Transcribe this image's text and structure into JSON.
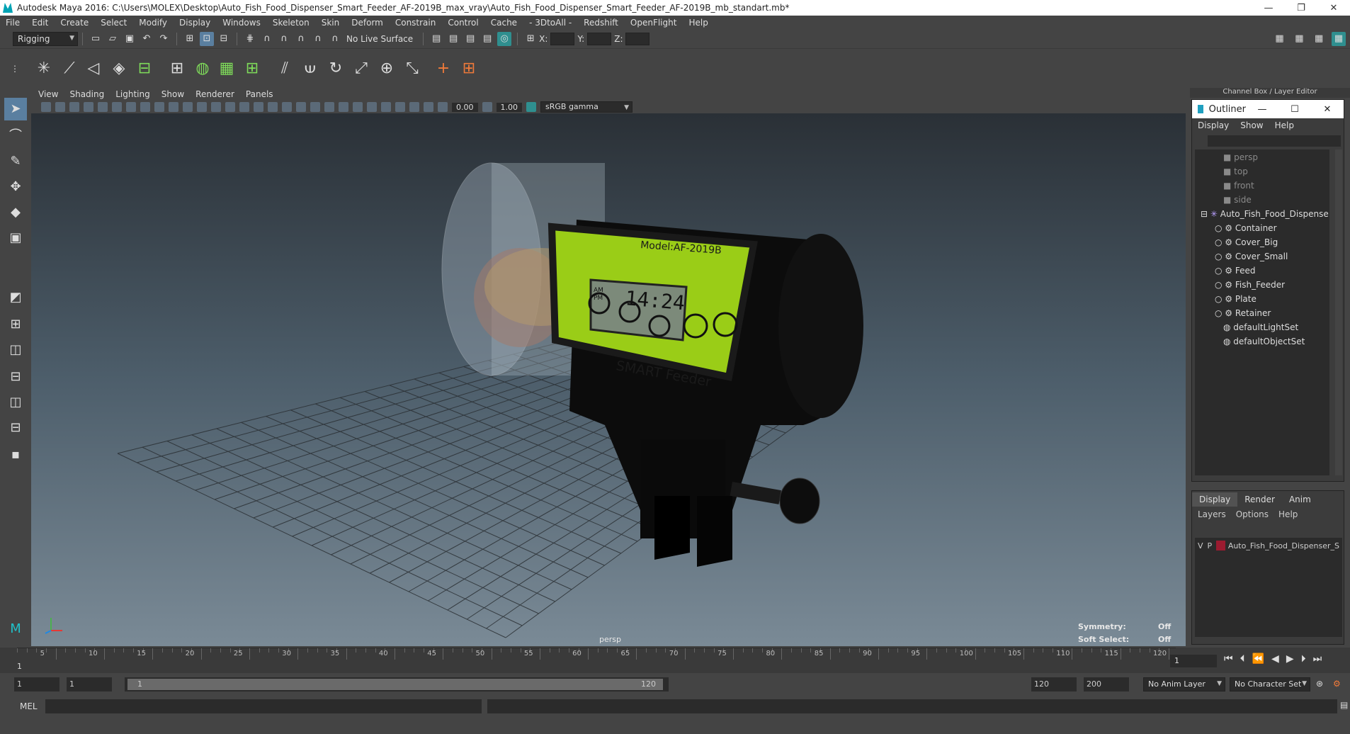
{
  "window": {
    "title": "Autodesk Maya 2016: C:\\Users\\MOLEX\\Desktop\\Auto_Fish_Food_Dispenser_Smart_Feeder_AF-2019B_max_vray\\Auto_Fish_Food_Dispenser_Smart_Feeder_AF-2019B_mb_standart.mb*",
    "controls": [
      "—",
      "❐",
      "✕"
    ]
  },
  "menubar": [
    "File",
    "Edit",
    "Create",
    "Select",
    "Modify",
    "Display",
    "Windows",
    "Skeleton",
    "Skin",
    "Deform",
    "Constrain",
    "Control",
    "Cache",
    "- 3DtoAll -",
    "Redshift",
    "OpenFlight",
    "Help"
  ],
  "statusline": {
    "menuset": "Rigging",
    "live_surface": "No Live Surface",
    "x_label": "X:",
    "y_label": "Y:",
    "z_label": "Z:"
  },
  "viewport": {
    "menu": [
      "View",
      "Shading",
      "Lighting",
      "Show",
      "Renderer",
      "Panels"
    ],
    "near_value": "0.00",
    "far_value": "1.00",
    "color_space": "sRGB gamma",
    "camera_label": "persp",
    "hud": {
      "symmetry_label": "Symmetry:",
      "symmetry_value": "Off",
      "soft_select_label": "Soft Select:",
      "soft_select_value": "Off"
    },
    "model": {
      "model_text": "Model:AF-2019B",
      "time": "14:24",
      "am": "AM",
      "pm": "PM",
      "brand": "SMART Feeder"
    }
  },
  "channel_box_title": "Channel Box / Layer Editor",
  "outliner": {
    "title": "Outliner",
    "menu": [
      "Display",
      "Show",
      "Help"
    ],
    "cameras": [
      "persp",
      "top",
      "front",
      "side"
    ],
    "root": "Auto_Fish_Food_Dispense",
    "children": [
      "Container",
      "Cover_Big",
      "Cover_Small",
      "Feed",
      "Fish_Feeder",
      "Plate",
      "Retainer"
    ],
    "sets": [
      "defaultLightSet",
      "defaultObjectSet"
    ]
  },
  "layer_editor": {
    "tabs": [
      "Display",
      "Render",
      "Anim"
    ],
    "menu": [
      "Layers",
      "Options",
      "Help"
    ],
    "layer": {
      "v": "V",
      "p": "P",
      "name": "Auto_Fish_Food_Dispenser_S",
      "color": "#9b1b30"
    }
  },
  "timeslider": {
    "ticks": [
      "5",
      "10",
      "15",
      "20",
      "25",
      "30",
      "35",
      "40",
      "45",
      "50",
      "55",
      "60",
      "65",
      "70",
      "75",
      "80",
      "85",
      "90",
      "95",
      "100",
      "105",
      "110",
      "115",
      "120"
    ],
    "start_tick": "1",
    "current_frame": "1"
  },
  "rangeslider": {
    "start_frame": "1",
    "playback_start": "1",
    "range_start": "1",
    "range_end": "120",
    "playback_end": "120",
    "end_frame": "200",
    "anim_layer": "No Anim Layer",
    "character_set": "No Character Set"
  },
  "cmdline": {
    "label": "MEL"
  }
}
